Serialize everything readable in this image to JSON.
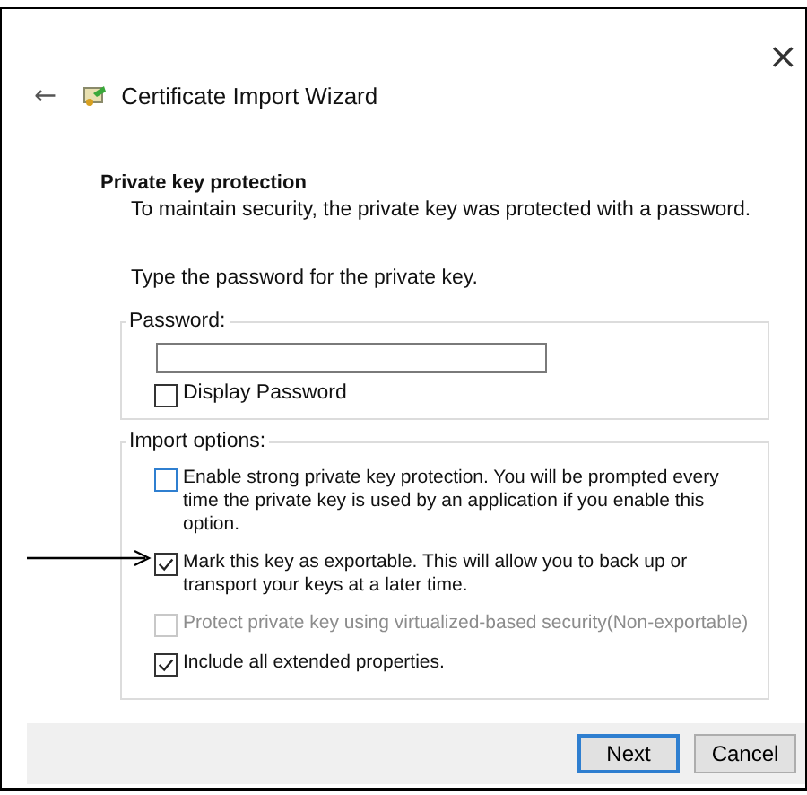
{
  "window": {
    "title": "Certificate Import Wizard",
    "close": "×",
    "back": "←"
  },
  "header": {
    "title": "Private key protection",
    "subtitle": "To maintain security, the private key was protected with a password."
  },
  "prompt": "Type the password for the private key.",
  "password_group": {
    "legend": "Password:",
    "display_password": {
      "label": "Display Password",
      "checked": false
    }
  },
  "import_options": {
    "legend": "Import options:",
    "options": [
      {
        "label": "Enable strong private key protection. You will be prompted every time the private key is used by an application if you enable this option.",
        "checked": false,
        "kind": "focused"
      },
      {
        "label": "Mark this key as exportable. This will allow you to back up or transport your keys at a later time.",
        "checked": true,
        "kind": "normal"
      },
      {
        "label": "Protect private key using virtualized-based security(Non-exportable)",
        "checked": false,
        "kind": "disabled"
      },
      {
        "label": "Include all extended properties.",
        "checked": true,
        "kind": "normal"
      }
    ]
  },
  "buttons": [
    {
      "label": "Next",
      "default": true
    },
    {
      "label": "Cancel",
      "default": false
    }
  ]
}
